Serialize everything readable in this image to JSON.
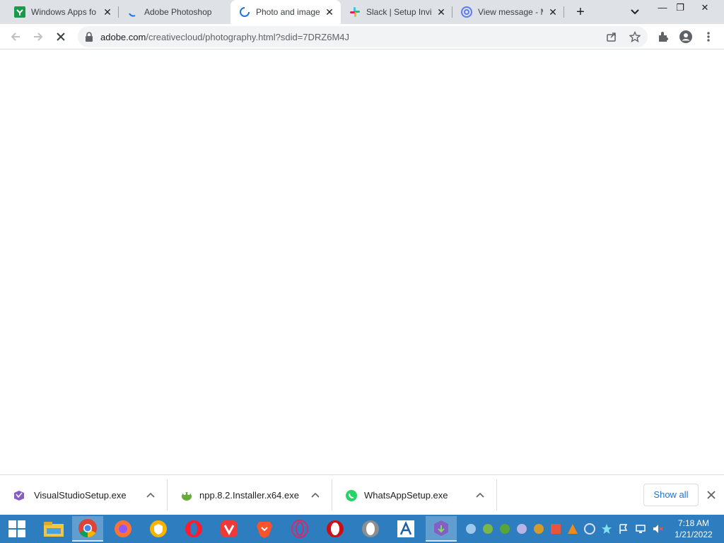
{
  "browser": {
    "tabs": [
      {
        "title": "Windows Apps fo",
        "favicon": "uptodown-icon",
        "active": false
      },
      {
        "title": "Adobe Photoshop",
        "favicon": "loading-icon",
        "active": false
      },
      {
        "title": "Photo and image",
        "favicon": "spinner-icon",
        "active": true
      },
      {
        "title": "Slack | Setup Invit",
        "favicon": "slack-icon",
        "active": false
      },
      {
        "title": "View message - M",
        "favicon": "at-sign-icon",
        "active": false
      }
    ],
    "close_glyph": "✕",
    "new_tab_glyph": "+",
    "window_controls": {
      "minimize": "—",
      "restore": "❐",
      "close": "✕"
    }
  },
  "toolbar": {
    "url_host": "adobe.com",
    "url_path": "/creativecloud/photography.html?sdid=7DRZ6M4J"
  },
  "downloads": {
    "items": [
      {
        "name": "VisualStudioSetup.exe",
        "icon": "visual-studio-icon"
      },
      {
        "name": "npp.8.2.Installer.x64.exe",
        "icon": "notepad-plus-plus-icon"
      },
      {
        "name": "WhatsAppSetup.exe",
        "icon": "whatsapp-icon"
      }
    ],
    "show_all": "Show all"
  },
  "taskbar": {
    "time": "7:18 AM",
    "date": "1/21/2022"
  },
  "colors": {
    "tabstrip": "#dee1e6",
    "accent_blue": "#1a73e8",
    "taskbar": "#2d7dbf"
  }
}
